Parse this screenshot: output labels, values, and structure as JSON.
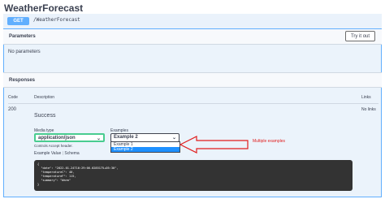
{
  "title": "WeatherForecast",
  "operation": {
    "method": "GET",
    "path": "/WeatherForecast"
  },
  "parameters": {
    "heading": "Parameters",
    "try_label": "Try it out",
    "empty_text": "No parameters"
  },
  "responses": {
    "heading": "Responses",
    "col_code": "Code",
    "col_description": "Description",
    "col_links": "Links",
    "code": "200",
    "description": "Success",
    "links": "No links",
    "media_label": "Media type",
    "media_value": "application/json",
    "accept_note": "Controls Accept header.",
    "examples_label": "Examples",
    "examples_selected": "Example 2",
    "example_options": [
      "Example 1",
      "Example 2"
    ],
    "tab_value": "Example Value",
    "tab_schema": "Schema",
    "code_lines": [
      "{",
      "  \"date\": \"2022-01-24T16:29:06.0285175+05:30\",",
      "  \"temperatureC\": 40,",
      "  \"temperatureF\": 115,",
      "  \"summary\": \"Warm\"",
      "}"
    ]
  },
  "annotation": {
    "text": "Multiple examples",
    "color": "#e11d1d"
  },
  "colors": {
    "get_blue": "#61affe",
    "media_border_green": "#49cc90",
    "code_bg": "#333333",
    "selected_option": "#1e90ff"
  }
}
